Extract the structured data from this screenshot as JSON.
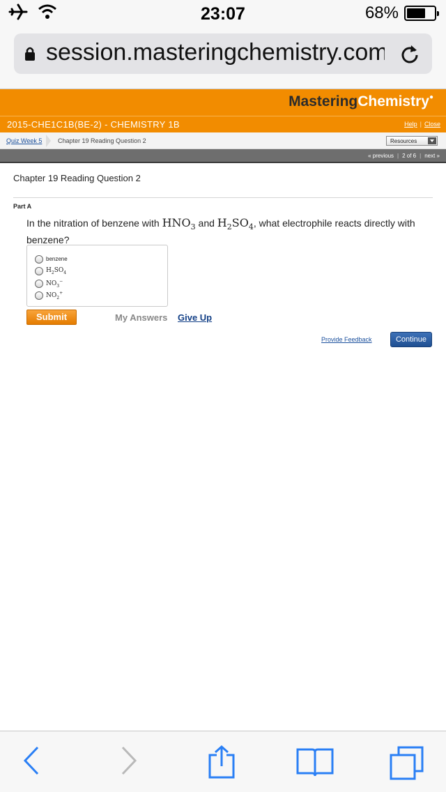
{
  "status_bar": {
    "time": "23:07",
    "battery_percent_text": "68%",
    "battery_level": 0.68
  },
  "browser": {
    "url": "session.masteringchemistry.com"
  },
  "header": {
    "logo_part1": "Mastering",
    "logo_part2": "Chemistry",
    "course_title": "2015-CHE1C1B(BE-2) - CHEMISTRY 1B",
    "help_link": "Help",
    "close_link": "Close"
  },
  "breadcrumb": {
    "assignment": "Quiz Week 5",
    "current": "Chapter 19 Reading Question 2",
    "resources_label": "Resources"
  },
  "pager": {
    "previous": "« previous",
    "position": "2 of 6",
    "next": "next »"
  },
  "question": {
    "title": "Chapter 19 Reading Question 2",
    "part": "Part A",
    "prompt_before": "In the nitration of benzene with ",
    "reagent1_base": "HNO",
    "reagent1_sub": "3",
    "prompt_and": " and ",
    "reagent2_h": "H",
    "reagent2_sub1": "2",
    "reagent2_so": "SO",
    "reagent2_sub2": "4",
    "prompt_after": ", what electrophile reacts directly with benzene?",
    "choices": [
      {
        "label": "benzene"
      },
      {
        "base1": "H",
        "sub1": "2",
        "base2": "SO",
        "sub2": "4"
      },
      {
        "base": "NO",
        "sub": "3",
        "sup": "−"
      },
      {
        "base": "NO",
        "sub": "2",
        "sup": "+"
      }
    ]
  },
  "actions": {
    "submit": "Submit",
    "my_answers": "My Answers",
    "give_up": "Give Up",
    "provide_feedback": "Provide Feedback",
    "continue": "Continue"
  }
}
